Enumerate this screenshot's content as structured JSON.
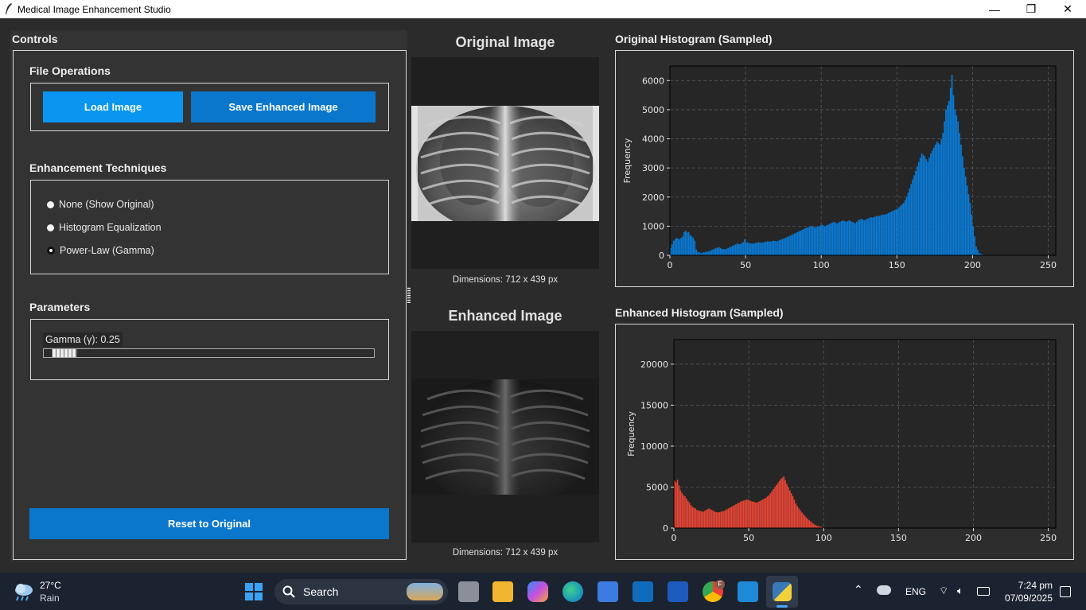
{
  "window": {
    "title": "Medical Image Enhancement Studio",
    "min_glyph": "—",
    "max_glyph": "❐",
    "close_glyph": "✕"
  },
  "controls": {
    "title": "Controls",
    "file_ops": {
      "title": "File Operations",
      "load_label": "Load Image",
      "save_label": "Save Enhanced Image"
    },
    "techniques": {
      "title": "Enhancement Techniques",
      "options": [
        "None (Show Original)",
        "Histogram Equalization",
        "Power-Law (Gamma)"
      ],
      "selected_index": 2
    },
    "parameters": {
      "title": "Parameters",
      "gamma_label": "Gamma (γ): 0.25",
      "gamma_value": 0.25
    },
    "reset_label": "Reset to Original"
  },
  "images": {
    "original_title": "Original Image",
    "enhanced_title": "Enhanced Image",
    "original_dims": "Dimensions: 712 x 439 px",
    "enhanced_dims": "Dimensions: 712 x 439 px"
  },
  "chart_data": [
    {
      "type": "bar",
      "title": "Original Histogram (Sampled)",
      "xlabel": "",
      "ylabel": "Frequency",
      "xlim": [
        0,
        255
      ],
      "ylim": [
        0,
        6500
      ],
      "xticks": [
        0,
        50,
        100,
        150,
        200,
        250
      ],
      "yticks": [
        0,
        1000,
        2000,
        3000,
        4000,
        5000,
        6000
      ],
      "color": "#0a7ad5",
      "grid": true,
      "points": [
        [
          0,
          250
        ],
        [
          2,
          500
        ],
        [
          4,
          600
        ],
        [
          6,
          550
        ],
        [
          8,
          650
        ],
        [
          9,
          800
        ],
        [
          10,
          850
        ],
        [
          11,
          780
        ],
        [
          12,
          800
        ],
        [
          13,
          700
        ],
        [
          14,
          650
        ],
        [
          15,
          600
        ],
        [
          16,
          500
        ],
        [
          17,
          200
        ],
        [
          18,
          120
        ],
        [
          20,
          80
        ],
        [
          22,
          100
        ],
        [
          24,
          120
        ],
        [
          26,
          150
        ],
        [
          28,
          200
        ],
        [
          30,
          250
        ],
        [
          32,
          280
        ],
        [
          34,
          220
        ],
        [
          36,
          200
        ],
        [
          38,
          250
        ],
        [
          40,
          300
        ],
        [
          42,
          350
        ],
        [
          44,
          400
        ],
        [
          46,
          380
        ],
        [
          48,
          450
        ],
        [
          49,
          550
        ],
        [
          50,
          450
        ],
        [
          52,
          420
        ],
        [
          54,
          400
        ],
        [
          56,
          420
        ],
        [
          58,
          450
        ],
        [
          60,
          430
        ],
        [
          62,
          450
        ],
        [
          64,
          480
        ],
        [
          66,
          470
        ],
        [
          68,
          500
        ],
        [
          70,
          480
        ],
        [
          72,
          520
        ],
        [
          74,
          560
        ],
        [
          76,
          600
        ],
        [
          78,
          650
        ],
        [
          80,
          700
        ],
        [
          82,
          750
        ],
        [
          84,
          800
        ],
        [
          86,
          850
        ],
        [
          88,
          900
        ],
        [
          90,
          950
        ],
        [
          92,
          980
        ],
        [
          94,
          1000
        ],
        [
          96,
          950
        ],
        [
          98,
          1000
        ],
        [
          100,
          1050
        ],
        [
          102,
          1000
        ],
        [
          104,
          1050
        ],
        [
          106,
          1100
        ],
        [
          108,
          1150
        ],
        [
          110,
          1100
        ],
        [
          112,
          1150
        ],
        [
          114,
          1200
        ],
        [
          116,
          1150
        ],
        [
          118,
          1200
        ],
        [
          120,
          1150
        ],
        [
          122,
          1100
        ],
        [
          124,
          1200
        ],
        [
          126,
          1250
        ],
        [
          128,
          1200
        ],
        [
          130,
          1250
        ],
        [
          132,
          1300
        ],
        [
          134,
          1300
        ],
        [
          136,
          1350
        ],
        [
          138,
          1350
        ],
        [
          140,
          1400
        ],
        [
          142,
          1400
        ],
        [
          144,
          1450
        ],
        [
          146,
          1500
        ],
        [
          148,
          1550
        ],
        [
          150,
          1600
        ],
        [
          152,
          1700
        ],
        [
          154,
          1800
        ],
        [
          156,
          2000
        ],
        [
          158,
          2300
        ],
        [
          160,
          2600
        ],
        [
          162,
          2900
        ],
        [
          164,
          3200
        ],
        [
          166,
          3500
        ],
        [
          168,
          3400
        ],
        [
          170,
          3200
        ],
        [
          172,
          3500
        ],
        [
          174,
          3700
        ],
        [
          176,
          3900
        ],
        [
          178,
          3800
        ],
        [
          180,
          4200
        ],
        [
          182,
          5000
        ],
        [
          184,
          5300
        ],
        [
          186,
          6200
        ],
        [
          187,
          5500
        ],
        [
          188,
          5000
        ],
        [
          190,
          4600
        ],
        [
          192,
          3800
        ],
        [
          194,
          3000
        ],
        [
          196,
          2400
        ],
        [
          198,
          1800
        ],
        [
          200,
          1000
        ],
        [
          202,
          300
        ],
        [
          204,
          80
        ],
        [
          206,
          30
        ],
        [
          208,
          10
        ],
        [
          210,
          0
        ],
        [
          255,
          0
        ]
      ]
    },
    {
      "type": "bar",
      "title": "Enhanced Histogram (Sampled)",
      "xlabel": "",
      "ylabel": "Frequency",
      "xlim": [
        0,
        255
      ],
      "ylim": [
        0,
        23000
      ],
      "xticks": [
        0,
        50,
        100,
        150,
        200,
        250
      ],
      "yticks": [
        0,
        5000,
        10000,
        15000,
        20000
      ],
      "color": "#e64535",
      "grid": true,
      "points": [
        [
          0,
          5800
        ],
        [
          1,
          5600
        ],
        [
          2,
          5900
        ],
        [
          3,
          5200
        ],
        [
          4,
          4600
        ],
        [
          5,
          4300
        ],
        [
          6,
          4000
        ],
        [
          7,
          3900
        ],
        [
          8,
          3600
        ],
        [
          9,
          3300
        ],
        [
          10,
          3100
        ],
        [
          11,
          2800
        ],
        [
          12,
          2600
        ],
        [
          13,
          2500
        ],
        [
          14,
          2400
        ],
        [
          15,
          2200
        ],
        [
          17,
          2100
        ],
        [
          19,
          2000
        ],
        [
          21,
          2200
        ],
        [
          23,
          2400
        ],
        [
          25,
          2200
        ],
        [
          27,
          2000
        ],
        [
          29,
          1900
        ],
        [
          31,
          2000
        ],
        [
          33,
          2100
        ],
        [
          35,
          2300
        ],
        [
          37,
          2500
        ],
        [
          39,
          2700
        ],
        [
          41,
          2900
        ],
        [
          43,
          3100
        ],
        [
          45,
          3300
        ],
        [
          47,
          3400
        ],
        [
          49,
          3500
        ],
        [
          51,
          3300
        ],
        [
          53,
          3200
        ],
        [
          55,
          3100
        ],
        [
          57,
          3300
        ],
        [
          59,
          3500
        ],
        [
          61,
          3700
        ],
        [
          63,
          4000
        ],
        [
          65,
          4500
        ],
        [
          67,
          5000
        ],
        [
          69,
          5500
        ],
        [
          71,
          6000
        ],
        [
          73,
          6300
        ],
        [
          75,
          5400
        ],
        [
          77,
          4600
        ],
        [
          79,
          3900
        ],
        [
          81,
          3000
        ],
        [
          83,
          2400
        ],
        [
          85,
          1900
        ],
        [
          87,
          1500
        ],
        [
          89,
          1100
        ],
        [
          91,
          800
        ],
        [
          93,
          500
        ],
        [
          95,
          300
        ],
        [
          97,
          180
        ],
        [
          99,
          90
        ],
        [
          101,
          40
        ],
        [
          103,
          10
        ],
        [
          255,
          0
        ]
      ]
    }
  ],
  "taskbar": {
    "temp": "27°C",
    "weather": "Rain",
    "search_label": "Search",
    "lang": "ENG",
    "time": "7:24 pm",
    "date": "07/09/2025",
    "profile_badge": "F"
  }
}
